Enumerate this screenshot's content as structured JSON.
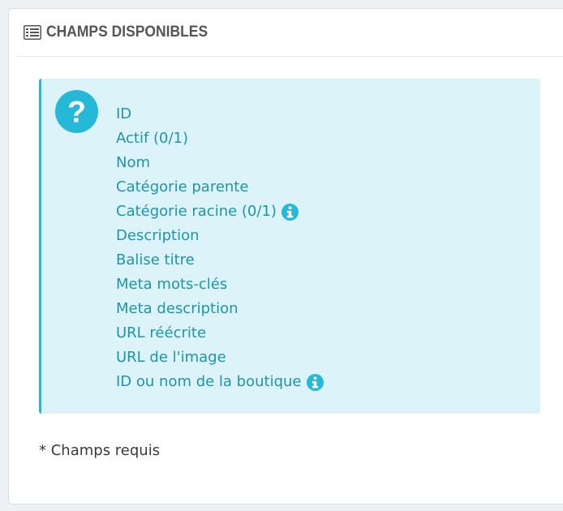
{
  "panel": {
    "title": "CHAMPS DISPONIBLES",
    "icon": "list-icon"
  },
  "alert": {
    "icon": "question-circle-icon",
    "accent_color": "#25b9d7",
    "background_color": "#dcf4f9",
    "text_color": "#1e94ab",
    "fields": [
      {
        "label": "ID",
        "info": false
      },
      {
        "label": "Actif (0/1)",
        "info": false
      },
      {
        "label": "Nom",
        "info": false
      },
      {
        "label": "Catégorie parente",
        "info": false
      },
      {
        "label": "Catégorie racine (0/1)",
        "info": true
      },
      {
        "label": "Description",
        "info": false
      },
      {
        "label": "Balise titre",
        "info": false
      },
      {
        "label": "Meta mots-clés",
        "info": false
      },
      {
        "label": "Meta description",
        "info": false
      },
      {
        "label": "URL réécrite",
        "info": false
      },
      {
        "label": "URL de l'image",
        "info": false
      },
      {
        "label": "ID ou nom de la boutique",
        "info": true
      }
    ]
  },
  "footer": {
    "required_note": "* Champs requis"
  }
}
